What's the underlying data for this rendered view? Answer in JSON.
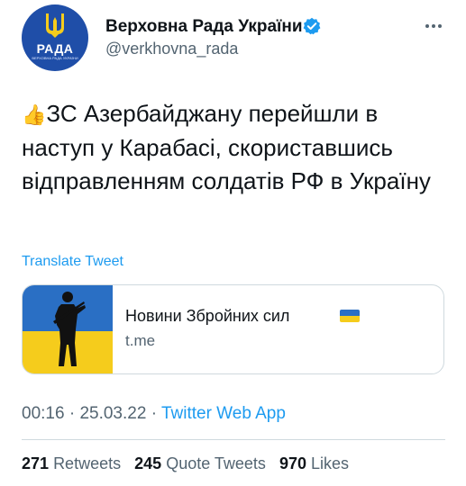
{
  "account": {
    "display_name": "Верховна Рада України",
    "handle": "@verkhovna_rada",
    "avatar_text": "РАДА",
    "avatar_subtext": "ВЕРХОВНА РАДА УКРАЇНИ",
    "brand_color": "#1f4ea8",
    "verified_color": "#1d9bf0"
  },
  "tweet": {
    "emoji": "👍",
    "text": "ЗС Азербайджану перейшли в наступ у Карабасі, скориставшись відправленням солдатів РФ в Україну",
    "translate_label": "Translate Tweet"
  },
  "card": {
    "title": "Новини Збройних сил",
    "domain": "t.me",
    "flag_colors": [
      "#2a6fc4",
      "#f5cc1c"
    ]
  },
  "meta": {
    "time": "00:16",
    "date": "25.03.22",
    "separator": "·",
    "source": "Twitter Web App"
  },
  "stats": {
    "retweets_count": "271",
    "retweets_label": "Retweets",
    "quotes_count": "245",
    "quotes_label": "Quote Tweets",
    "likes_count": "970",
    "likes_label": "Likes"
  }
}
